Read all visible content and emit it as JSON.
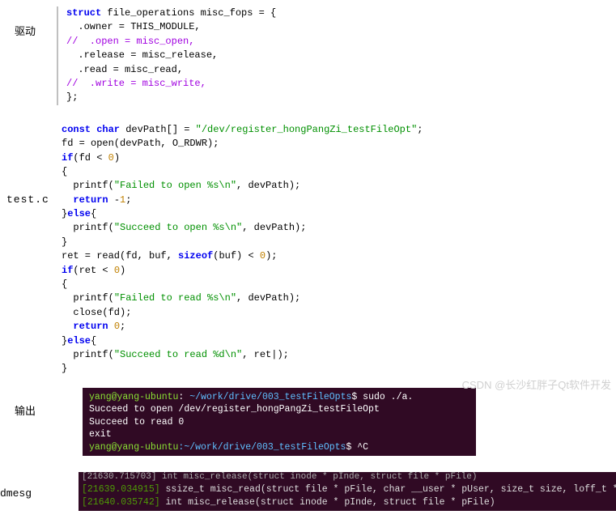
{
  "labels": {
    "driver": "驱动",
    "testc": "test.c",
    "output": "输出",
    "dmesg": "dmesg"
  },
  "driver_code": {
    "l1a": "struct",
    "l1b": " file_operations misc_fops = {",
    "l2": "  .owner = THIS_MODULE,",
    "l3": "//  .open = misc_open,",
    "l4": "  .release = misc_release,",
    "l5": "  .read = misc_read,",
    "l6": "//  .write = misc_write,",
    "l7": "};"
  },
  "test_code": {
    "l1a": "const char",
    "l1b": " devPath[] = ",
    "l1c": "\"/dev/register_hongPangZi_testFileOpt\"",
    "l1d": ";",
    "l2": "fd = open(devPath, O_RDWR);",
    "l3a": "if",
    "l3b": "(fd < ",
    "l3c": "0",
    "l3d": ")",
    "l4": "{",
    "l5a": "  printf(",
    "l5b": "\"Failed to open %s\\n\"",
    "l5c": ", devPath);",
    "l6a": "  ",
    "l6b": "return",
    "l6c": " -",
    "l6d": "1",
    "l6e": ";",
    "l7a": "}",
    "l7b": "else",
    "l7c": "{",
    "l8a": "  printf(",
    "l8b": "\"Succeed to open %s\\n\"",
    "l8c": ", devPath);",
    "l9": "}",
    "l10a": "ret = read(fd, buf, ",
    "l10b": "sizeof",
    "l10c": "(buf) < ",
    "l10d": "0",
    "l10e": ");",
    "l11a": "if",
    "l11b": "(ret < ",
    "l11c": "0",
    "l11d": ")",
    "l12": "{",
    "l13a": "  printf(",
    "l13b": "\"Failed to read %s\\n\"",
    "l13c": ", devPath);",
    "l14": "  close(fd);",
    "l15a": "  ",
    "l15b": "return",
    "l15c": " ",
    "l15d": "0",
    "l15e": ";",
    "l16a": "}",
    "l16b": "else",
    "l16c": "{",
    "l17a": "  printf(",
    "l17b": "\"Succeed to read %d\\n\"",
    "l17c": ", ret|);",
    "l18": "}"
  },
  "term": {
    "prompt_user": "yang@yang-ubuntu",
    "prompt_sep": ": ",
    "prompt_path": "~/work/drive/003_testFileOpts",
    "prompt_cmd": "$ sudo ./a.",
    "l2": "Succeed to open /dev/register_hongPangZi_testFileOpt",
    "l3": "Succeed to read 0",
    "l4": "exit",
    "l5u": "yang@yang-ubuntu",
    "l5p": ":~/work/drive/003_testFileOpts",
    "l5e": "$ ^C"
  },
  "dmesg": {
    "top": "[21630.715703] int misc_release(struct inode * pInde, struct file * pFile)",
    "ts1": "[21639.034915]",
    "ln1": " ssize_t misc_read(struct file * pFile, char __user * pUser, size_t size, loff_t * pOfft)",
    "ts2": "[21640.035742]",
    "ln2": " int misc_release(struct inode * pInde, struct file * pFile)"
  },
  "watermark": "CSDN @长沙红胖子Qt软件开发"
}
